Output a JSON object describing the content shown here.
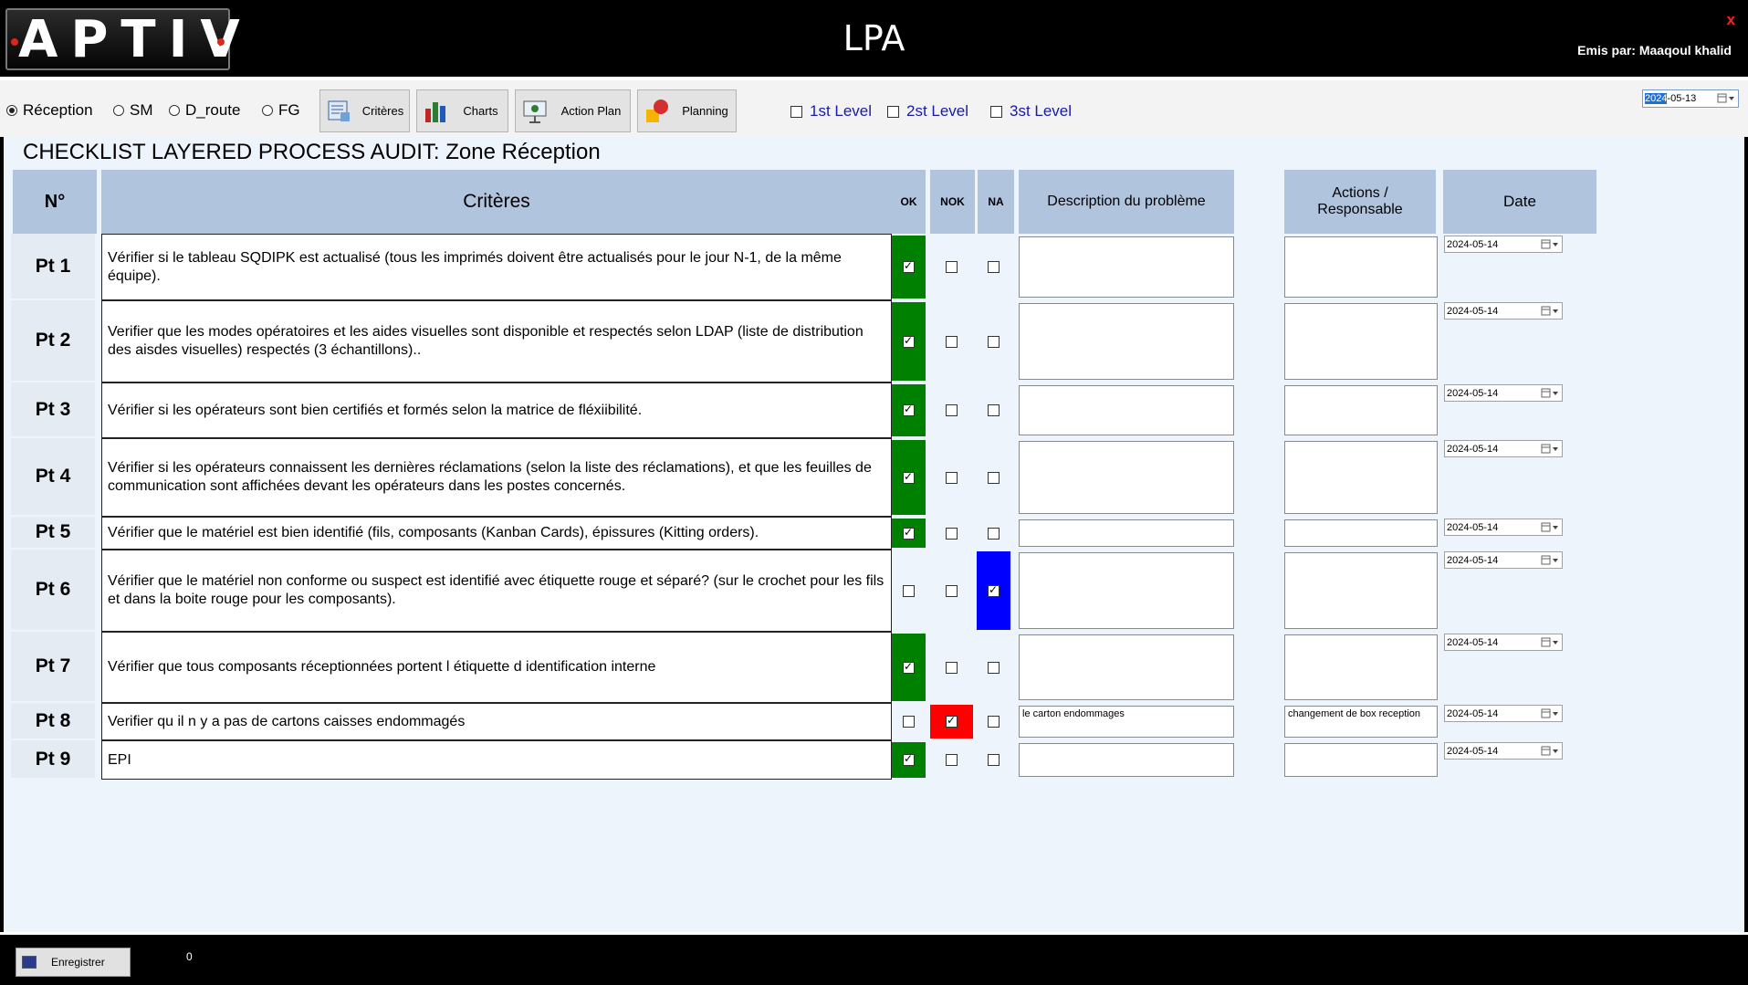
{
  "app": {
    "logo_text": "APTIV",
    "title": "LPA",
    "close": "x",
    "issued_by": "Emis par: Maaqoul khalid"
  },
  "zones": [
    {
      "label": "Réception",
      "selected": true
    },
    {
      "label": "SM",
      "selected": false
    },
    {
      "label": "D_route",
      "selected": false
    },
    {
      "label": "FG",
      "selected": false
    }
  ],
  "toolbar_buttons": {
    "criteres": "Critères",
    "charts": "Charts",
    "action_plan": "Action Plan",
    "planning": "Planning"
  },
  "levels": {
    "l1": "1st Level",
    "l2": "2st Level",
    "l3": "3st Level"
  },
  "top_date": {
    "year_selected": "2024",
    "rest": "-05-13"
  },
  "page_title": "CHECKLIST LAYERED PROCESS AUDIT: Zone Réception",
  "headers": {
    "num": "N°",
    "criteres": "Critères",
    "ok": "OK",
    "nok": "NOK",
    "na": "NA",
    "description": "Description du problème",
    "actions": "Actions / Responsable",
    "date": "Date"
  },
  "rows": [
    {
      "pt": "Pt 1",
      "critere": "Vérifier si le tableau SQDIPK est actualisé (tous les imprimés doivent être actualisés pour le jour N-1, de la même équipe).",
      "status": "ok",
      "description": "",
      "actions": "",
      "date": "2024-05-14"
    },
    {
      "pt": "Pt 2",
      "critere": "Verifier que les modes opératoires et les aides visuelles sont disponible et respectés selon LDAP (liste de distribution des aisdes visuelles) respectés (3 échantillons)..",
      "status": "ok",
      "description": "",
      "actions": "",
      "date": "2024-05-14"
    },
    {
      "pt": "Pt 3",
      "critere": "Vérifier si les opérateurs sont bien certifiés et formés selon la matrice de fléxiibilité.",
      "status": "ok",
      "description": "",
      "actions": "",
      "date": "2024-05-14"
    },
    {
      "pt": "Pt 4",
      "critere": "Vérifier si les opérateurs connaissent les dernières réclamations (selon la liste des réclamations), et que les feuilles de communication sont affichées devant les opérateurs dans les postes concernés.",
      "status": "ok",
      "description": "",
      "actions": "",
      "date": "2024-05-14"
    },
    {
      "pt": "Pt 5",
      "critere": "Vérifier que le matériel est bien identifié (fils, composants (Kanban Cards), épissures (Kitting orders).",
      "status": "ok",
      "description": "",
      "actions": "",
      "date": "2024-05-14"
    },
    {
      "pt": "Pt 6",
      "critere": "Vérifier que le matériel non conforme ou suspect est identifié avec étiquette rouge et séparé? (sur le crochet pour les fils et dans la boite rouge pour les composants).",
      "status": "na",
      "description": "",
      "actions": "",
      "date": "2024-05-14"
    },
    {
      "pt": "Pt 7",
      "critere": "Vérifier que tous composants réceptionnées portent l étiquette d identification interne",
      "status": "ok",
      "description": "",
      "actions": "",
      "date": "2024-05-14"
    },
    {
      "pt": "Pt 8",
      "critere": "Verifier qu il n y a pas de cartons  caisses endommagés",
      "status": "nok",
      "description": "le carton endommages",
      "actions": "changement de box reception",
      "date": "2024-05-14"
    },
    {
      "pt": "Pt 9",
      "critere": "EPI",
      "status": "ok",
      "description": "",
      "actions": "",
      "date": "2024-05-14"
    }
  ],
  "footer": {
    "save": "Enregistrer",
    "counter": "0"
  },
  "colors": {
    "ok": "#008000",
    "nok": "#ff0000",
    "na": "#0000ff",
    "header_bg": "#b0c4de"
  }
}
